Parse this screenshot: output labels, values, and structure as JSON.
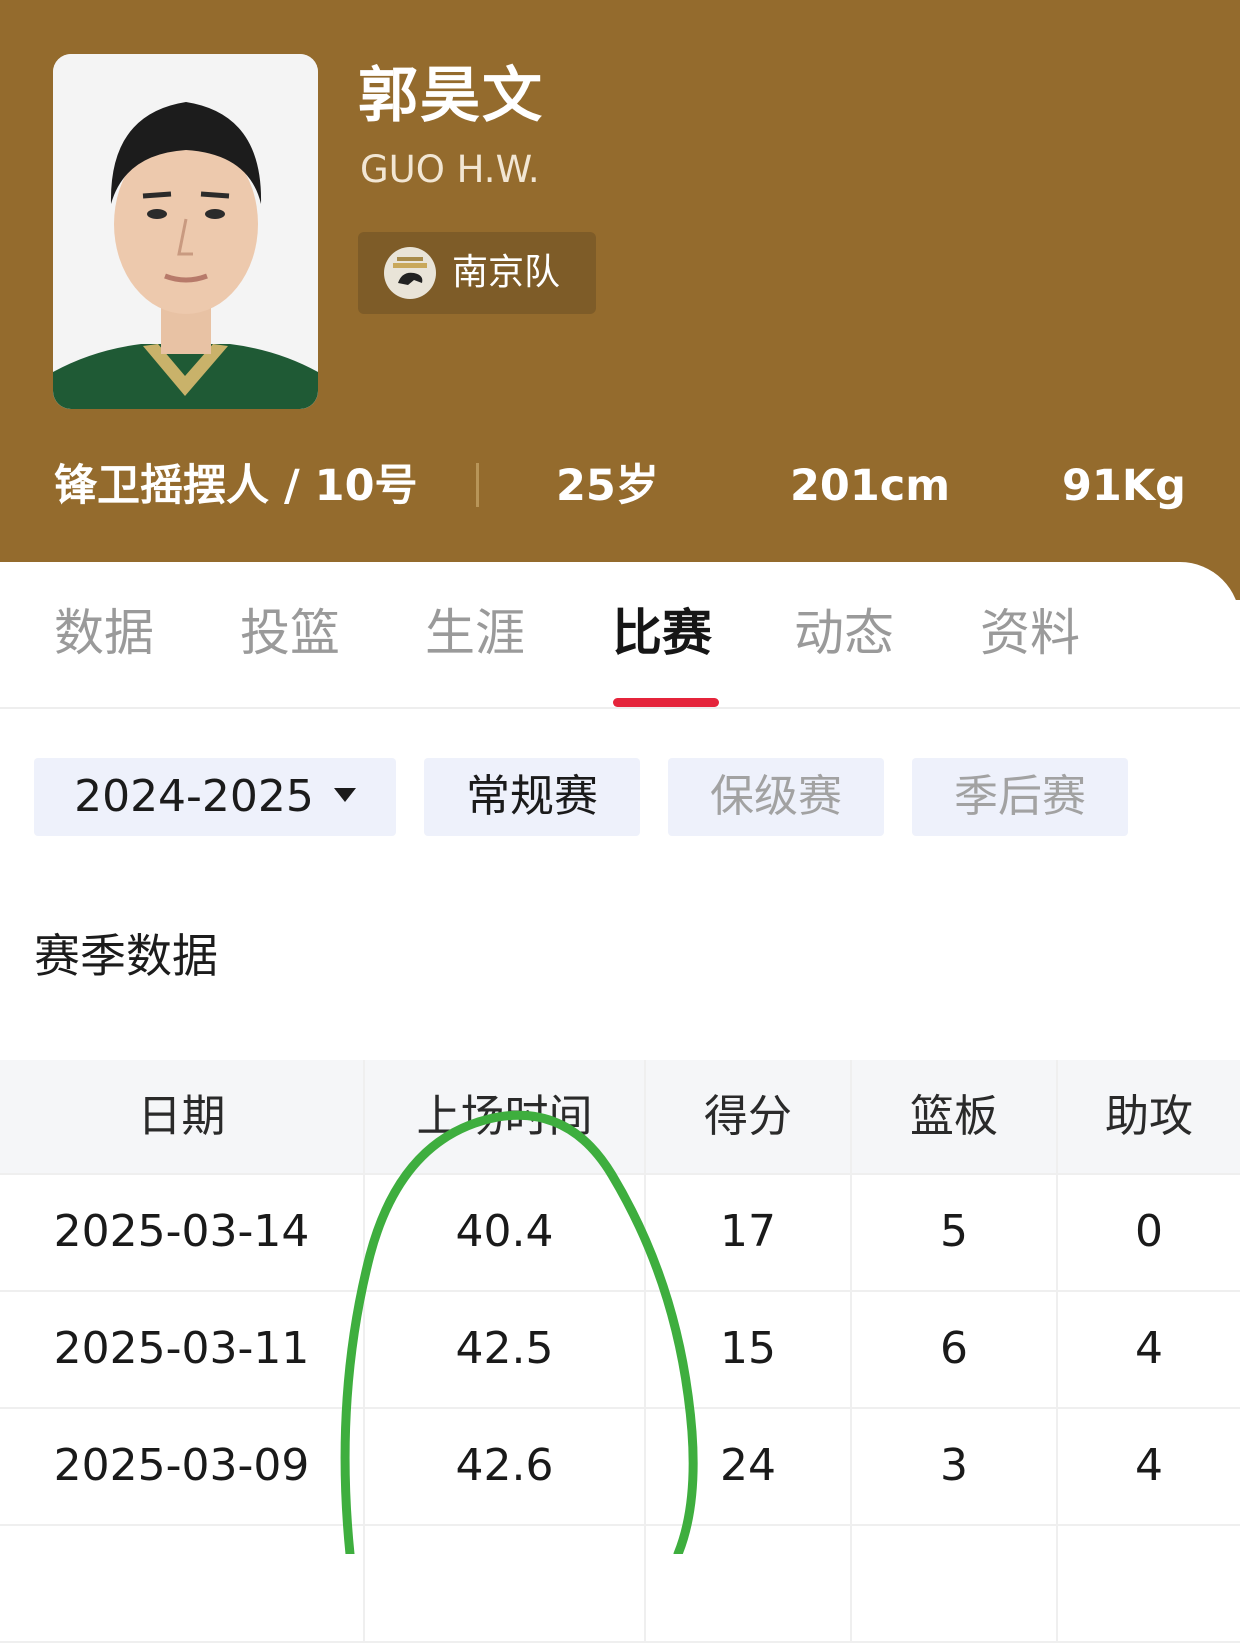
{
  "player": {
    "name_cn": "郭昊文",
    "name_en": "GUO H.W.",
    "team": "南京队",
    "position_number": "锋卫摇摆人 / 10号",
    "age": "25岁",
    "height": "201cm",
    "weight": "91Kg"
  },
  "tabs": [
    {
      "label": "数据",
      "active": false
    },
    {
      "label": "投篮",
      "active": false
    },
    {
      "label": "生涯",
      "active": false
    },
    {
      "label": "比赛",
      "active": true
    },
    {
      "label": "动态",
      "active": false
    },
    {
      "label": "资料",
      "active": false
    }
  ],
  "filters": {
    "season": "2024-2025",
    "types": [
      {
        "label": "常规赛",
        "selected": true
      },
      {
        "label": "保级赛",
        "selected": false
      },
      {
        "label": "季后赛",
        "selected": false
      }
    ]
  },
  "section_title": "赛季数据",
  "table": {
    "columns": [
      "日期",
      "上场时间",
      "得分",
      "篮板",
      "助攻"
    ],
    "rows": [
      [
        "2025-03-14",
        "40.4",
        "17",
        "5",
        "0"
      ],
      [
        "2025-03-11",
        "42.5",
        "15",
        "6",
        "4"
      ],
      [
        "2025-03-09",
        "42.6",
        "24",
        "3",
        "4"
      ]
    ]
  },
  "colors": {
    "header_bg": "#946b2d",
    "tab_indicator": "#e5243b",
    "annotation": "#3eae3e"
  }
}
